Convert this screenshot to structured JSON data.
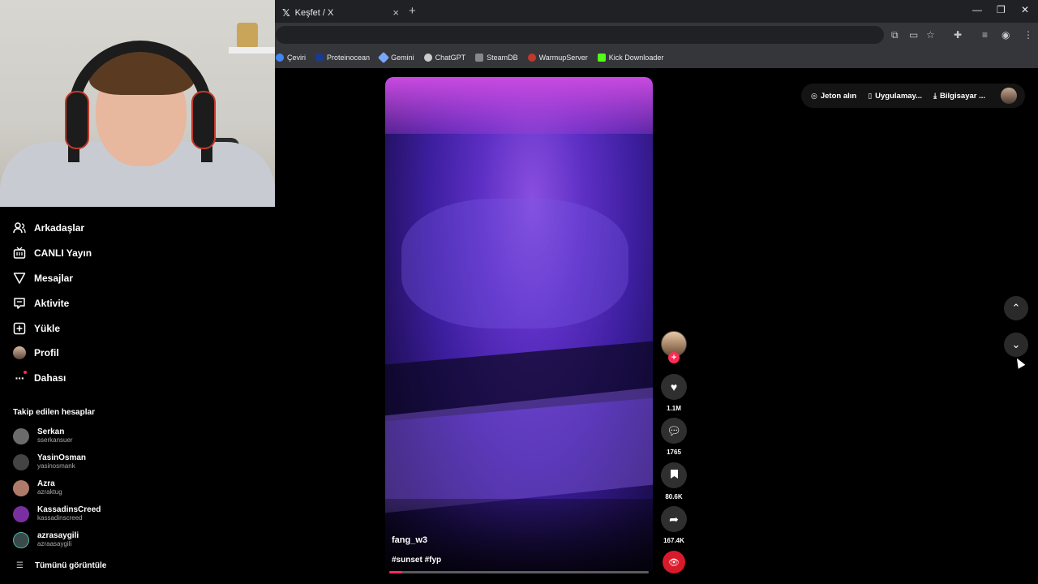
{
  "browser": {
    "tab_title": "Keşfet / X",
    "tab_icon": "x-logo-icon",
    "new_tab": "+",
    "bookmarks": [
      {
        "label": "Çeviri",
        "icon": "google-icon",
        "color": "#4285f4"
      },
      {
        "label": "Proteinocean",
        "icon": "p-icon",
        "color": "#1b3a8a"
      },
      {
        "label": "Gemini",
        "icon": "gemini-icon",
        "color": "#7aa6ff"
      },
      {
        "label": "ChatGPT",
        "icon": "chatgpt-icon",
        "color": "#cccccc"
      },
      {
        "label": "SteamDB",
        "icon": "steamdb-icon",
        "color": "#888888"
      },
      {
        "label": "WarmupServer",
        "icon": "warmup-icon",
        "color": "#c0392b"
      },
      {
        "label": "Kick Downloader",
        "icon": "kick-icon",
        "color": "#53fc18"
      }
    ]
  },
  "sidebar": {
    "items": [
      {
        "label": "Arkadaşlar",
        "icon": "friends-icon"
      },
      {
        "label": "CANLI Yayın",
        "icon": "live-icon"
      },
      {
        "label": "Mesajlar",
        "icon": "messages-icon"
      },
      {
        "label": "Aktivite",
        "icon": "activity-icon"
      },
      {
        "label": "Yükle",
        "icon": "upload-icon"
      },
      {
        "label": "Profil",
        "icon": "profile-avatar-icon"
      },
      {
        "label": "Dahası",
        "icon": "more-icon"
      }
    ],
    "following_title": "Takip edilen hesaplar",
    "following": [
      {
        "name": "Serkan",
        "user": "sserkansuer",
        "color": "#6b6b6b"
      },
      {
        "name": "YasinOsman",
        "user": "yasinosmank",
        "color": "#444444"
      },
      {
        "name": "Azra",
        "user": "azraktug",
        "color": "#b07a6a"
      },
      {
        "name": "KassadinsCreed",
        "user": "kassadinscreed",
        "color": "#7a2fa0"
      },
      {
        "name": "azrasaygili",
        "user": "azraasaygili",
        "color": "#3a4a4a"
      }
    ],
    "see_all": "Tümünü görüntüle"
  },
  "video": {
    "username": "fang_w3",
    "tags": "#sunset #fyp",
    "progress": 0.05
  },
  "actions": {
    "likes": "1.1M",
    "comments": "1765",
    "saves": "80.6K",
    "shares": "167.4K"
  },
  "top_menu": {
    "coins": "Jeton alın",
    "app": "Uygulamay...",
    "desktop": "Bilgisayar ..."
  },
  "colors": {
    "accent": "#fe2c55",
    "background": "#000000"
  }
}
